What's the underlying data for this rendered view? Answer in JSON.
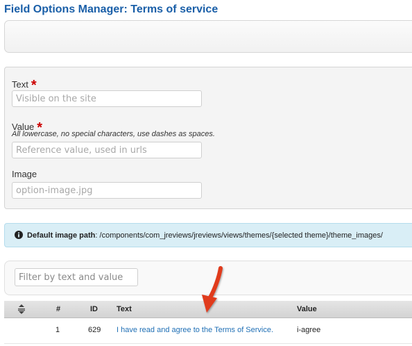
{
  "page": {
    "title": "Field Options Manager: Terms of service"
  },
  "form": {
    "text_label": "Text",
    "text_placeholder": "Visible on the site",
    "value_label": "Value",
    "value_hint": "All lowercase, no special characters, use dashes as spaces.",
    "value_placeholder": "Reference value, used in urls",
    "image_label": "Image",
    "image_placeholder": "option-image.jpg",
    "required_marker": "*"
  },
  "info": {
    "label": "Default image path",
    "path": ": /components/com_jreviews/jreviews/views/themes/{selected theme}/theme_images/"
  },
  "filter": {
    "placeholder": "Filter by text and value"
  },
  "table": {
    "headers": {
      "num": "#",
      "id": "ID",
      "text": "Text",
      "value": "Value"
    },
    "rows": [
      {
        "num": "1",
        "id": "629",
        "text": "I have read and agree to the Terms of Service.",
        "value": "i-agree"
      }
    ]
  },
  "annotation": {
    "arrow_color": "#e03a1f",
    "points_to": "table.headers.text"
  },
  "colors": {
    "title": "#1a5fa8",
    "link": "#1f6fb5",
    "required": "#cc0000",
    "info_bg": "#d9eef6"
  }
}
